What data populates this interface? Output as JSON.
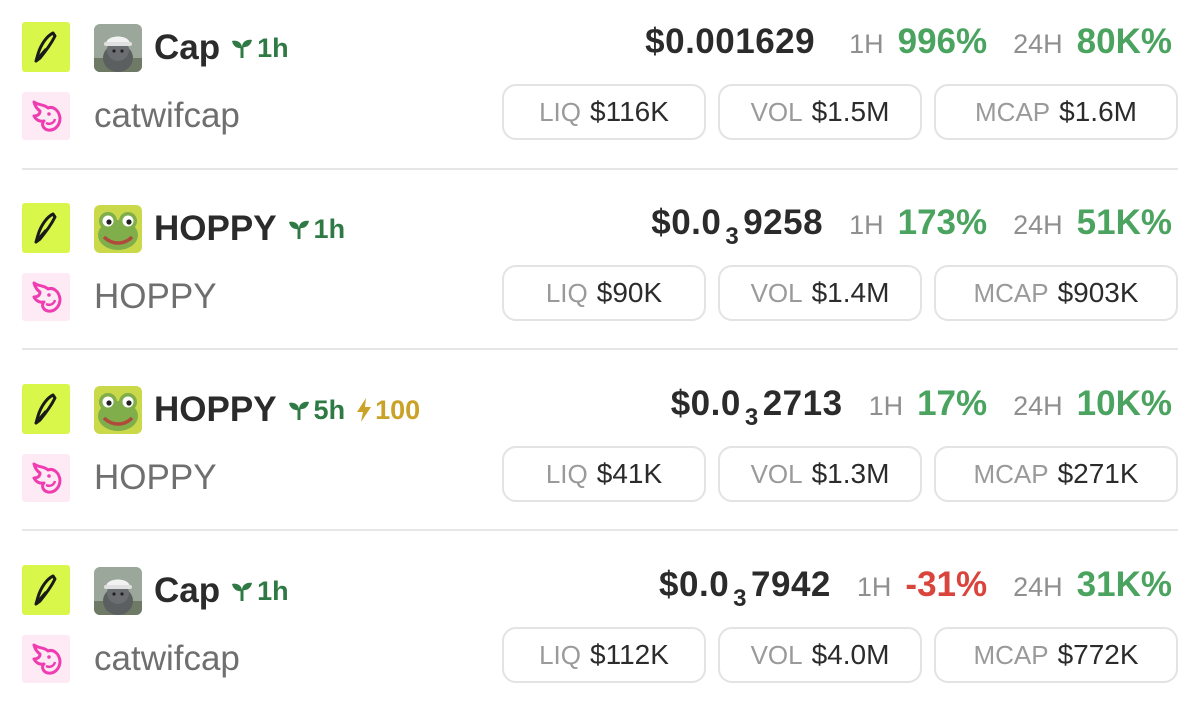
{
  "colors": {
    "positive": "#4aa35f",
    "negative": "#d9443d",
    "age_green": "#2f7a44",
    "boost_gold": "#c9a227",
    "platform_bg": "#d9f74a",
    "dex_pink": "#ef3db1"
  },
  "rows": [
    {
      "avatar": "cat-with-cap-avatar",
      "name": "Cap",
      "age": "1h",
      "boost": "",
      "symbol": "catwifcap",
      "price_main": "$0.001629",
      "price_sub": "",
      "price_tail": "",
      "h1_label": "1H",
      "h1_value": "996%",
      "h1_negative": false,
      "h24_label": "24H",
      "h24_value": "80K%",
      "liq_label": "LIQ",
      "liq_value": "$116K",
      "vol_label": "VOL",
      "vol_value": "$1.5M",
      "mcap_label": "MCAP",
      "mcap_value": "$1.6M"
    },
    {
      "avatar": "frog-avatar",
      "name": "HOPPY",
      "age": "1h",
      "boost": "",
      "symbol": "HOPPY",
      "price_main": "$0.0",
      "price_sub": "3",
      "price_tail": "9258",
      "h1_label": "1H",
      "h1_value": "173%",
      "h1_negative": false,
      "h24_label": "24H",
      "h24_value": "51K%",
      "liq_label": "LIQ",
      "liq_value": "$90K",
      "vol_label": "VOL",
      "vol_value": "$1.4M",
      "mcap_label": "MCAP",
      "mcap_value": "$903K"
    },
    {
      "avatar": "frog-avatar",
      "name": "HOPPY",
      "age": "5h",
      "boost": "100",
      "symbol": "HOPPY",
      "price_main": "$0.0",
      "price_sub": "3",
      "price_tail": "2713",
      "h1_label": "1H",
      "h1_value": "17%",
      "h1_negative": false,
      "h24_label": "24H",
      "h24_value": "10K%",
      "liq_label": "LIQ",
      "liq_value": "$41K",
      "vol_label": "VOL",
      "vol_value": "$1.3M",
      "mcap_label": "MCAP",
      "mcap_value": "$271K"
    },
    {
      "avatar": "cat-with-cap-avatar",
      "name": "Cap",
      "age": "1h",
      "boost": "",
      "symbol": "catwifcap",
      "price_main": "$0.0",
      "price_sub": "3",
      "price_tail": "7942",
      "h1_label": "1H",
      "h1_value": "-31%",
      "h1_negative": true,
      "h24_label": "24H",
      "h24_value": "31K%",
      "liq_label": "LIQ",
      "liq_value": "$112K",
      "vol_label": "VOL",
      "vol_value": "$4.0M",
      "mcap_label": "MCAP",
      "mcap_value": "$772K"
    }
  ]
}
